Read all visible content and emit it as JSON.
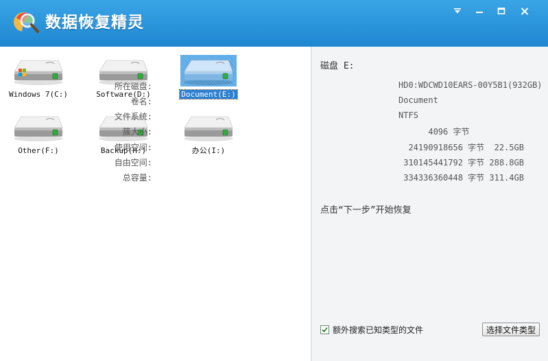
{
  "app": {
    "title": "数据恢复精灵",
    "accent": "#2a93d9"
  },
  "window_controls": [
    {
      "name": "menu-dropdown-icon"
    },
    {
      "name": "minimize-icon"
    },
    {
      "name": "maximize-icon"
    },
    {
      "name": "close-icon"
    }
  ],
  "drives": [
    {
      "label": "Windows 7(C:)",
      "os_badge": true,
      "selected": false
    },
    {
      "label": "Software(D:)",
      "os_badge": false,
      "selected": false
    },
    {
      "label": "Document(E:)",
      "os_badge": false,
      "selected": true
    },
    {
      "label": "Other(F:)",
      "os_badge": false,
      "selected": false
    },
    {
      "label": "Backup(H:)",
      "os_badge": false,
      "selected": false
    },
    {
      "label": "办公(I:)",
      "os_badge": false,
      "selected": false
    }
  ],
  "details": {
    "disk_title": "磁盘 E:",
    "rows": [
      {
        "key": "所在磁盘:",
        "value": "HD0:WDCWD10EARS-00Y5B1(932GB)"
      },
      {
        "key": "卷名:",
        "value": "Document"
      },
      {
        "key": "文件系统:",
        "value": "NTFS"
      },
      {
        "key": "簇大小:",
        "value": "      4096 字节"
      },
      {
        "key": "使用空间:",
        "value": "  24190918656 字节  22.5GB"
      },
      {
        "key": "自由空间:",
        "value": " 310145441792 字节 288.8GB"
      },
      {
        "key": "总容量:",
        "value": " 334336360448 字节 311.4GB"
      }
    ],
    "hint": "点击“下一步”开始恢复"
  },
  "footer": {
    "checkbox_label": "额外搜索已知类型的文件",
    "checkbox_checked": true,
    "select_types_button": "选择文件类型"
  }
}
